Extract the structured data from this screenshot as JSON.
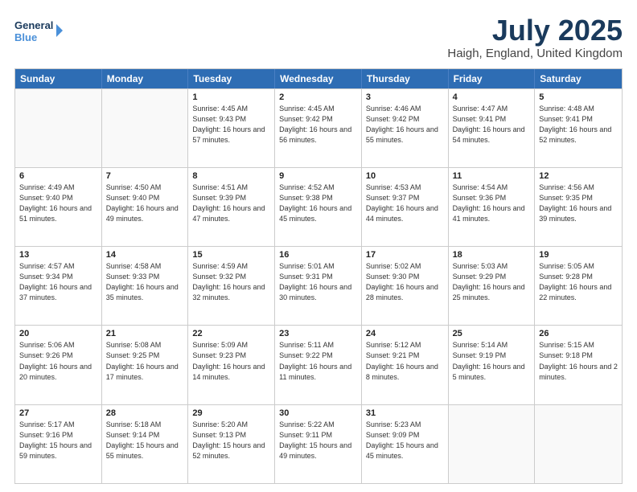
{
  "logo": {
    "line1": "General",
    "line2": "Blue"
  },
  "title": "July 2025",
  "subtitle": "Haigh, England, United Kingdom",
  "headers": [
    "Sunday",
    "Monday",
    "Tuesday",
    "Wednesday",
    "Thursday",
    "Friday",
    "Saturday"
  ],
  "weeks": [
    [
      {
        "day": "",
        "sunrise": "",
        "sunset": "",
        "daylight": ""
      },
      {
        "day": "",
        "sunrise": "",
        "sunset": "",
        "daylight": ""
      },
      {
        "day": "1",
        "sunrise": "Sunrise: 4:45 AM",
        "sunset": "Sunset: 9:43 PM",
        "daylight": "Daylight: 16 hours and 57 minutes."
      },
      {
        "day": "2",
        "sunrise": "Sunrise: 4:45 AM",
        "sunset": "Sunset: 9:42 PM",
        "daylight": "Daylight: 16 hours and 56 minutes."
      },
      {
        "day": "3",
        "sunrise": "Sunrise: 4:46 AM",
        "sunset": "Sunset: 9:42 PM",
        "daylight": "Daylight: 16 hours and 55 minutes."
      },
      {
        "day": "4",
        "sunrise": "Sunrise: 4:47 AM",
        "sunset": "Sunset: 9:41 PM",
        "daylight": "Daylight: 16 hours and 54 minutes."
      },
      {
        "day": "5",
        "sunrise": "Sunrise: 4:48 AM",
        "sunset": "Sunset: 9:41 PM",
        "daylight": "Daylight: 16 hours and 52 minutes."
      }
    ],
    [
      {
        "day": "6",
        "sunrise": "Sunrise: 4:49 AM",
        "sunset": "Sunset: 9:40 PM",
        "daylight": "Daylight: 16 hours and 51 minutes."
      },
      {
        "day": "7",
        "sunrise": "Sunrise: 4:50 AM",
        "sunset": "Sunset: 9:40 PM",
        "daylight": "Daylight: 16 hours and 49 minutes."
      },
      {
        "day": "8",
        "sunrise": "Sunrise: 4:51 AM",
        "sunset": "Sunset: 9:39 PM",
        "daylight": "Daylight: 16 hours and 47 minutes."
      },
      {
        "day": "9",
        "sunrise": "Sunrise: 4:52 AM",
        "sunset": "Sunset: 9:38 PM",
        "daylight": "Daylight: 16 hours and 45 minutes."
      },
      {
        "day": "10",
        "sunrise": "Sunrise: 4:53 AM",
        "sunset": "Sunset: 9:37 PM",
        "daylight": "Daylight: 16 hours and 44 minutes."
      },
      {
        "day": "11",
        "sunrise": "Sunrise: 4:54 AM",
        "sunset": "Sunset: 9:36 PM",
        "daylight": "Daylight: 16 hours and 41 minutes."
      },
      {
        "day": "12",
        "sunrise": "Sunrise: 4:56 AM",
        "sunset": "Sunset: 9:35 PM",
        "daylight": "Daylight: 16 hours and 39 minutes."
      }
    ],
    [
      {
        "day": "13",
        "sunrise": "Sunrise: 4:57 AM",
        "sunset": "Sunset: 9:34 PM",
        "daylight": "Daylight: 16 hours and 37 minutes."
      },
      {
        "day": "14",
        "sunrise": "Sunrise: 4:58 AM",
        "sunset": "Sunset: 9:33 PM",
        "daylight": "Daylight: 16 hours and 35 minutes."
      },
      {
        "day": "15",
        "sunrise": "Sunrise: 4:59 AM",
        "sunset": "Sunset: 9:32 PM",
        "daylight": "Daylight: 16 hours and 32 minutes."
      },
      {
        "day": "16",
        "sunrise": "Sunrise: 5:01 AM",
        "sunset": "Sunset: 9:31 PM",
        "daylight": "Daylight: 16 hours and 30 minutes."
      },
      {
        "day": "17",
        "sunrise": "Sunrise: 5:02 AM",
        "sunset": "Sunset: 9:30 PM",
        "daylight": "Daylight: 16 hours and 28 minutes."
      },
      {
        "day": "18",
        "sunrise": "Sunrise: 5:03 AM",
        "sunset": "Sunset: 9:29 PM",
        "daylight": "Daylight: 16 hours and 25 minutes."
      },
      {
        "day": "19",
        "sunrise": "Sunrise: 5:05 AM",
        "sunset": "Sunset: 9:28 PM",
        "daylight": "Daylight: 16 hours and 22 minutes."
      }
    ],
    [
      {
        "day": "20",
        "sunrise": "Sunrise: 5:06 AM",
        "sunset": "Sunset: 9:26 PM",
        "daylight": "Daylight: 16 hours and 20 minutes."
      },
      {
        "day": "21",
        "sunrise": "Sunrise: 5:08 AM",
        "sunset": "Sunset: 9:25 PM",
        "daylight": "Daylight: 16 hours and 17 minutes."
      },
      {
        "day": "22",
        "sunrise": "Sunrise: 5:09 AM",
        "sunset": "Sunset: 9:23 PM",
        "daylight": "Daylight: 16 hours and 14 minutes."
      },
      {
        "day": "23",
        "sunrise": "Sunrise: 5:11 AM",
        "sunset": "Sunset: 9:22 PM",
        "daylight": "Daylight: 16 hours and 11 minutes."
      },
      {
        "day": "24",
        "sunrise": "Sunrise: 5:12 AM",
        "sunset": "Sunset: 9:21 PM",
        "daylight": "Daylight: 16 hours and 8 minutes."
      },
      {
        "day": "25",
        "sunrise": "Sunrise: 5:14 AM",
        "sunset": "Sunset: 9:19 PM",
        "daylight": "Daylight: 16 hours and 5 minutes."
      },
      {
        "day": "26",
        "sunrise": "Sunrise: 5:15 AM",
        "sunset": "Sunset: 9:18 PM",
        "daylight": "Daylight: 16 hours and 2 minutes."
      }
    ],
    [
      {
        "day": "27",
        "sunrise": "Sunrise: 5:17 AM",
        "sunset": "Sunset: 9:16 PM",
        "daylight": "Daylight: 15 hours and 59 minutes."
      },
      {
        "day": "28",
        "sunrise": "Sunrise: 5:18 AM",
        "sunset": "Sunset: 9:14 PM",
        "daylight": "Daylight: 15 hours and 55 minutes."
      },
      {
        "day": "29",
        "sunrise": "Sunrise: 5:20 AM",
        "sunset": "Sunset: 9:13 PM",
        "daylight": "Daylight: 15 hours and 52 minutes."
      },
      {
        "day": "30",
        "sunrise": "Sunrise: 5:22 AM",
        "sunset": "Sunset: 9:11 PM",
        "daylight": "Daylight: 15 hours and 49 minutes."
      },
      {
        "day": "31",
        "sunrise": "Sunrise: 5:23 AM",
        "sunset": "Sunset: 9:09 PM",
        "daylight": "Daylight: 15 hours and 45 minutes."
      },
      {
        "day": "",
        "sunrise": "",
        "sunset": "",
        "daylight": ""
      },
      {
        "day": "",
        "sunrise": "",
        "sunset": "",
        "daylight": ""
      }
    ]
  ]
}
